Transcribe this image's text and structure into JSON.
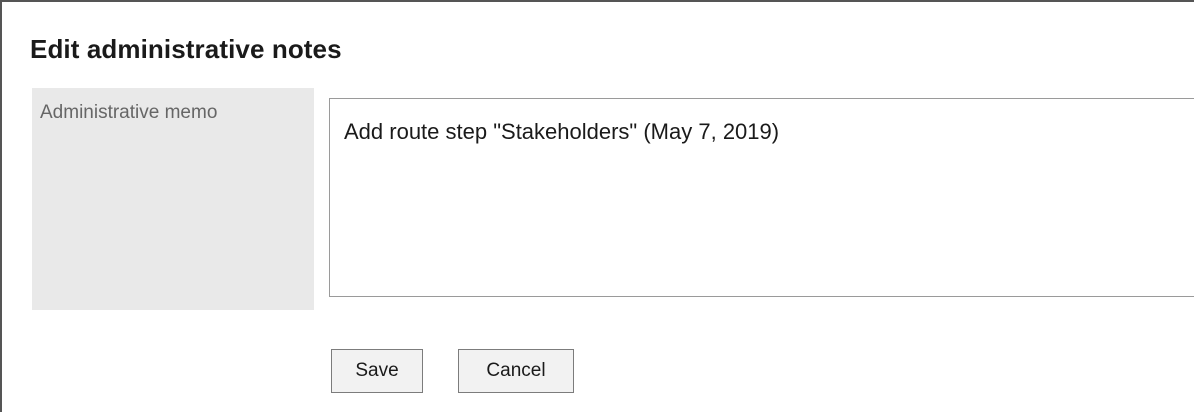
{
  "page": {
    "title": "Edit administrative notes"
  },
  "form": {
    "memo_label": "Administrative memo",
    "memo_value": "Add route step \"Stakeholders\" (May 7, 2019)"
  },
  "actions": {
    "save_label": "Save",
    "cancel_label": "Cancel"
  }
}
